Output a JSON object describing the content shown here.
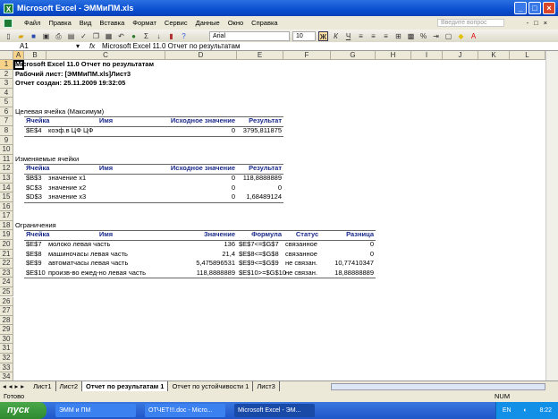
{
  "window": {
    "title": "Microsoft Excel - ЭММиПМ.xls",
    "app_icon": "X"
  },
  "menu": {
    "items": [
      "Файл",
      "Правка",
      "Вид",
      "Вставка",
      "Формат",
      "Сервис",
      "Данные",
      "Окно",
      "Справка"
    ],
    "ask_placeholder": "Введите вопрос"
  },
  "toolbar": {
    "font": "Arial",
    "size": "10",
    "bold": "Ж",
    "italic": "К",
    "underline": "Ч",
    "percent": "%",
    "sigma": "Σ"
  },
  "formula_bar": {
    "name_box": "A1",
    "fx": "fx",
    "value": "Microsoft Excel 11.0 Отчет по результатам"
  },
  "columns": [
    "A",
    "B",
    "C",
    "D",
    "E",
    "F",
    "G",
    "H",
    "I",
    "J",
    "K",
    "L"
  ],
  "row_count": 34,
  "cells": [
    {
      "r": 1,
      "c": "A",
      "t": "Microsoft Excel 11.0 Отчет по результатам",
      "s": "b"
    },
    {
      "r": 2,
      "c": "A",
      "t": "Рабочий лист: [ЭММиПМ.xls]Лист3",
      "s": "b"
    },
    {
      "r": 3,
      "c": "A",
      "t": "Отчет создан: 25.11.2009 19:32:05",
      "s": "b"
    },
    {
      "r": 6,
      "c": "A",
      "t": "Целевая ячейка (Максимум)"
    },
    {
      "r": 7,
      "c": "B",
      "t": "Ячейка",
      "s": "hdr"
    },
    {
      "r": 7,
      "c": "C",
      "t": "Имя",
      "s": "hdr",
      "a": "center"
    },
    {
      "r": 7,
      "c": "D",
      "t": "Исходное значение",
      "s": "hdr",
      "a": "right"
    },
    {
      "r": 7,
      "c": "E",
      "t": "Результат",
      "s": "hdr",
      "a": "right"
    },
    {
      "r": 8,
      "c": "B",
      "t": "$E$4"
    },
    {
      "r": 8,
      "c": "C",
      "t": "коэф.в ЦФ ЦФ"
    },
    {
      "r": 8,
      "c": "D",
      "t": "0",
      "a": "right"
    },
    {
      "r": 8,
      "c": "E",
      "t": "3795,811875",
      "a": "right"
    },
    {
      "r": 11,
      "c": "A",
      "t": "Изменяемые ячейки"
    },
    {
      "r": 12,
      "c": "B",
      "t": "Ячейка",
      "s": "hdr"
    },
    {
      "r": 12,
      "c": "C",
      "t": "Имя",
      "s": "hdr",
      "a": "center"
    },
    {
      "r": 12,
      "c": "D",
      "t": "Исходное значение",
      "s": "hdr",
      "a": "right"
    },
    {
      "r": 12,
      "c": "E",
      "t": "Результат",
      "s": "hdr",
      "a": "right"
    },
    {
      "r": 13,
      "c": "B",
      "t": "$B$3"
    },
    {
      "r": 13,
      "c": "C",
      "t": "значение x1"
    },
    {
      "r": 13,
      "c": "D",
      "t": "0",
      "a": "right"
    },
    {
      "r": 13,
      "c": "E",
      "t": "118,8888889",
      "a": "right"
    },
    {
      "r": 14,
      "c": "B",
      "t": "$C$3"
    },
    {
      "r": 14,
      "c": "C",
      "t": "значение x2"
    },
    {
      "r": 14,
      "c": "D",
      "t": "0",
      "a": "right"
    },
    {
      "r": 14,
      "c": "E",
      "t": "0",
      "a": "right"
    },
    {
      "r": 15,
      "c": "B",
      "t": "$D$3"
    },
    {
      "r": 15,
      "c": "C",
      "t": "значение x3"
    },
    {
      "r": 15,
      "c": "D",
      "t": "0",
      "a": "right"
    },
    {
      "r": 15,
      "c": "E",
      "t": "1,68489124",
      "a": "right"
    },
    {
      "r": 18,
      "c": "A",
      "t": "Ограничения"
    },
    {
      "r": 19,
      "c": "B",
      "t": "Ячейка",
      "s": "hdr"
    },
    {
      "r": 19,
      "c": "C",
      "t": "Имя",
      "s": "hdr",
      "a": "center"
    },
    {
      "r": 19,
      "c": "D",
      "t": "Значение",
      "s": "hdr",
      "a": "right"
    },
    {
      "r": 19,
      "c": "E",
      "t": "Формула",
      "s": "hdr",
      "a": "right"
    },
    {
      "r": 19,
      "c": "F",
      "t": "Статус",
      "s": "hdr",
      "a": "center"
    },
    {
      "r": 19,
      "c": "G",
      "t": "Разница",
      "s": "hdr",
      "a": "right"
    },
    {
      "r": 20,
      "c": "B",
      "t": "$E$7"
    },
    {
      "r": 20,
      "c": "C",
      "t": "молоко левая часть"
    },
    {
      "r": 20,
      "c": "D",
      "t": "136",
      "a": "right"
    },
    {
      "r": 20,
      "c": "E",
      "t": "$E$7<=$G$7"
    },
    {
      "r": 20,
      "c": "F",
      "t": "связанное"
    },
    {
      "r": 20,
      "c": "G",
      "t": "0",
      "a": "right"
    },
    {
      "r": 21,
      "c": "B",
      "t": "$E$8"
    },
    {
      "r": 21,
      "c": "C",
      "t": "машиночасы левая часть"
    },
    {
      "r": 21,
      "c": "D",
      "t": "21,4",
      "a": "right"
    },
    {
      "r": 21,
      "c": "E",
      "t": "$E$8<=$G$8"
    },
    {
      "r": 21,
      "c": "F",
      "t": "связанное"
    },
    {
      "r": 21,
      "c": "G",
      "t": "0",
      "a": "right"
    },
    {
      "r": 22,
      "c": "B",
      "t": "$E$9"
    },
    {
      "r": 22,
      "c": "C",
      "t": "автоматчасы левая часть"
    },
    {
      "r": 22,
      "c": "D",
      "t": "5,475896531",
      "a": "right"
    },
    {
      "r": 22,
      "c": "E",
      "t": "$E$9<=$G$9"
    },
    {
      "r": 22,
      "c": "F",
      "t": "не связан."
    },
    {
      "r": 22,
      "c": "G",
      "t": "10,77410347",
      "a": "right"
    },
    {
      "r": 23,
      "c": "B",
      "t": "$E$10"
    },
    {
      "r": 23,
      "c": "C",
      "t": "произв-во ежед-но левая часть"
    },
    {
      "r": 23,
      "c": "D",
      "t": "118,8888889",
      "a": "right"
    },
    {
      "r": 23,
      "c": "E",
      "t": "$E$10>=$G$10"
    },
    {
      "r": 23,
      "c": "F",
      "t": "не связан."
    },
    {
      "r": 23,
      "c": "G",
      "t": "18,88888889",
      "a": "right"
    }
  ],
  "sheet_tabs": [
    {
      "label": "Лист1"
    },
    {
      "label": "Лист2"
    },
    {
      "label": "Отчет по результатам 1",
      "active": true
    },
    {
      "label": "Отчет по устойчивости 1"
    },
    {
      "label": "Лист3"
    }
  ],
  "status": {
    "ready": "Готово",
    "num": "NUM"
  },
  "taskbar": {
    "start": "пуск",
    "tasks": [
      {
        "label": "ЭММ и ПМ"
      },
      {
        "label": "ОТЧЕТ!!!.doc - Micro..."
      },
      {
        "label": "Microsoft Excel - ЭМ...",
        "active": true
      }
    ],
    "lang": "EN",
    "clock": "8:22"
  }
}
